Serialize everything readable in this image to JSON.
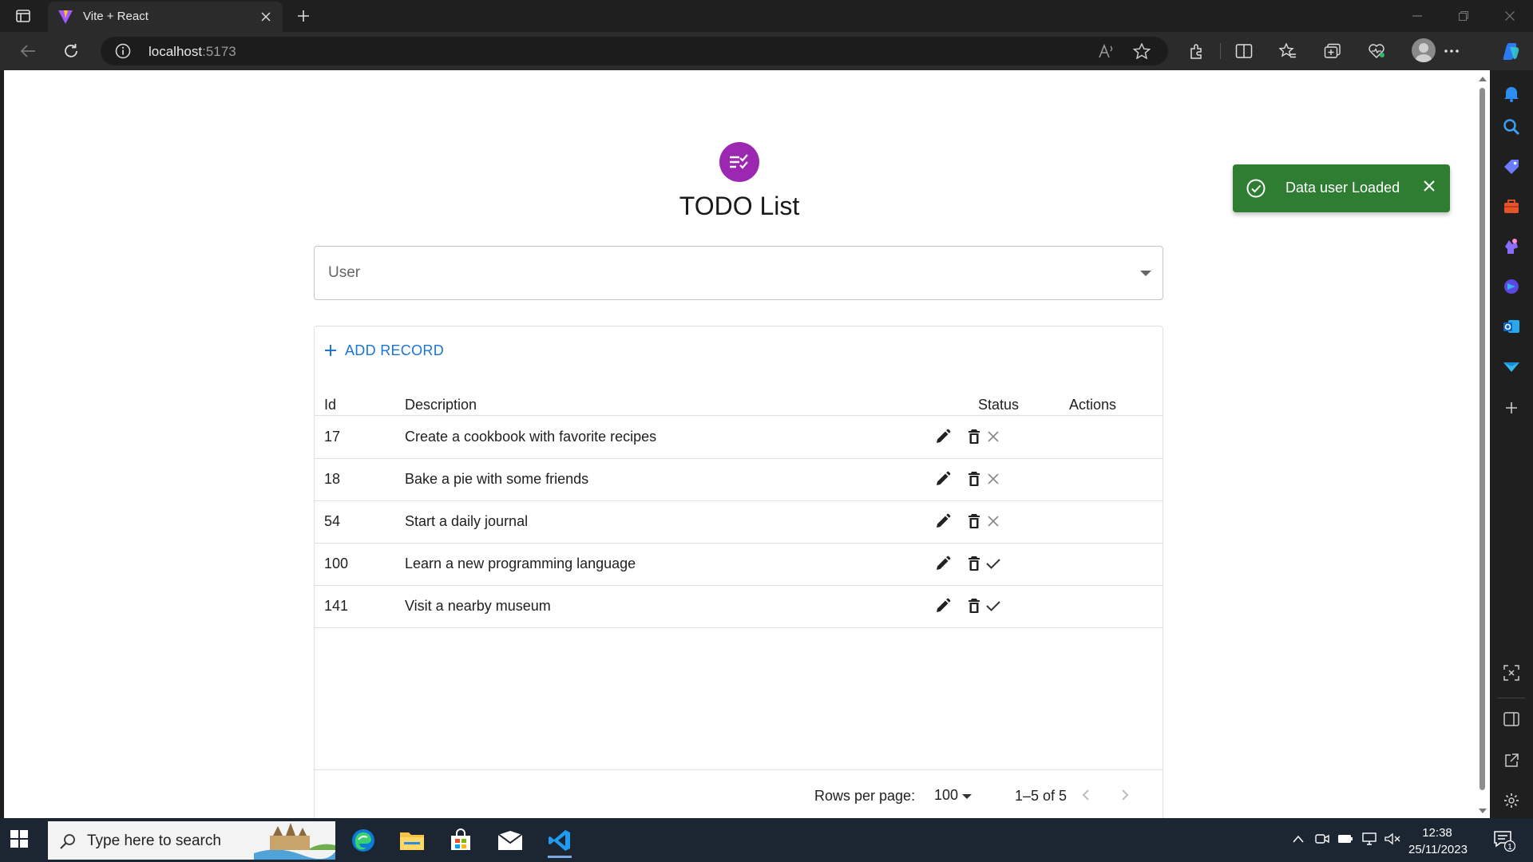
{
  "browser": {
    "tab_title": "Vite + React",
    "url_host": "localhost",
    "url_port": ":5173"
  },
  "app": {
    "title": "TODO List",
    "user_select_label": "User",
    "add_record_label": "ADD RECORD",
    "columns": [
      "Id",
      "Description",
      "Status",
      "Actions"
    ],
    "rows": [
      {
        "id": "17",
        "description": "Create a cookbook with favorite recipes",
        "completed": false
      },
      {
        "id": "18",
        "description": "Bake a pie with some friends",
        "completed": false
      },
      {
        "id": "54",
        "description": "Start a daily journal",
        "completed": false
      },
      {
        "id": "100",
        "description": "Learn a new programming language",
        "completed": true
      },
      {
        "id": "141",
        "description": "Visit a nearby museum",
        "completed": true
      }
    ],
    "footer": {
      "rows_per_page_label": "Rows per page:",
      "rows_per_page_value": "100",
      "range_text": "1–5 of 5"
    }
  },
  "toast": {
    "message": "Data user Loaded",
    "color": "#2e7d32"
  },
  "taskbar": {
    "search_placeholder": "Type here to search",
    "time": "12:38",
    "date": "25/11/2023",
    "notification_count": "1"
  },
  "colors": {
    "accent": "#1976d2",
    "logo": "#9c27b0"
  }
}
